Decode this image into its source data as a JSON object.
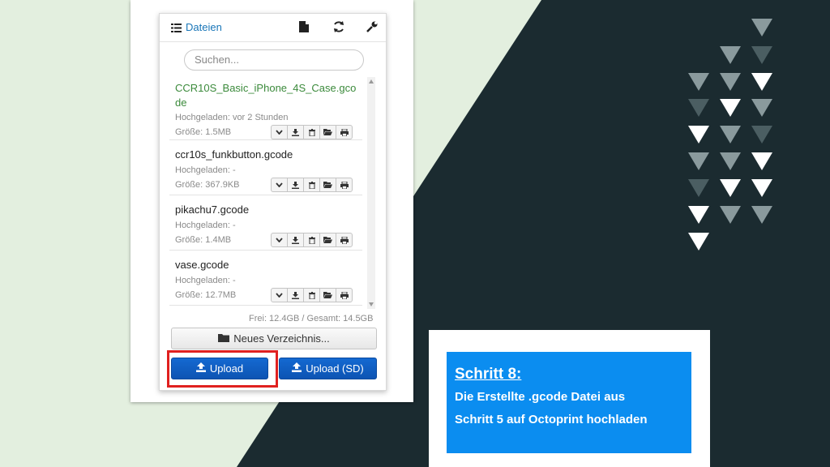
{
  "header": {
    "tab_label": "Dateien",
    "tab_icon": "list-icon",
    "icons": [
      "file-icon",
      "refresh-icon",
      "wrench-icon"
    ]
  },
  "search": {
    "placeholder": "Suchen..."
  },
  "files": [
    {
      "name": "CCR10S_Basic_iPhone_4S_Case.gcode",
      "uploaded": "Hochgeladen: vor 2 Stunden",
      "size": "Größe: 1.5MB",
      "active": true
    },
    {
      "name": "ccr10s_funkbutton.gcode",
      "uploaded": "Hochgeladen: -",
      "size": "Größe: 367.9KB",
      "active": false
    },
    {
      "name": "pikachu7.gcode",
      "uploaded": "Hochgeladen: -",
      "size": "Größe: 1.4MB",
      "active": false
    },
    {
      "name": "vase.gcode",
      "uploaded": "Hochgeladen: -",
      "size": "Größe: 12.7MB",
      "active": false
    }
  ],
  "file_button_icons": [
    "chevron-down-icon",
    "download-icon",
    "trash-icon",
    "folder-open-icon",
    "print-icon"
  ],
  "storage": "Frei: 12.4GB / Gesamt: 14.5GB",
  "buttons": {
    "new_folder": "Neues Verzeichnis...",
    "upload": "Upload",
    "upload_sd": "Upload (SD)"
  },
  "step": {
    "title": "Schritt 8:",
    "line1": "Die Erstellte .gcode Datei aus",
    "line2": "Schritt 5 auf Octoprint hochladen"
  },
  "colors": {
    "accent_blue": "#1469d1",
    "link_blue": "#1976b8",
    "active_file_green": "#3b8a3b",
    "highlight_red": "#e0201f",
    "card_blue": "#0b8df0",
    "background_dark": "#1b2b30",
    "background_light": "#e3efdf"
  }
}
